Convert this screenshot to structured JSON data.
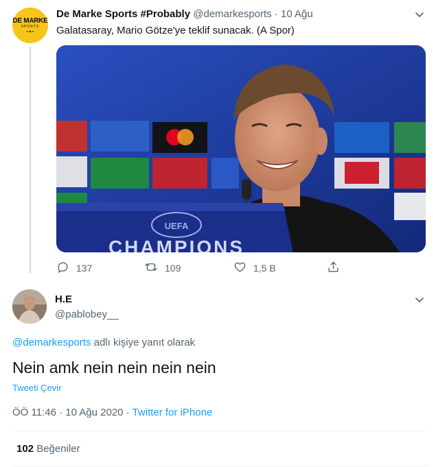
{
  "colors": {
    "accent": "#1d9bf0",
    "muted": "#536471",
    "text": "#0f1419",
    "avatar_bg": "#f5c518"
  },
  "parent_tweet": {
    "avatar_text": [
      "DE MARKE",
      "SPORTS",
      "● ◆ ●"
    ],
    "display_name": "De Marke Sports #Probably",
    "handle": "@demarkesports",
    "separator": "·",
    "date": "10 Ağu",
    "text": "Galatasaray, Mario Götze'ye teklif sunacak. (A Spor)",
    "media_text": "CHAMPIONS",
    "replies": "137",
    "retweets": "109",
    "likes": "1,5 B"
  },
  "reply_tweet": {
    "display_name": "H.E",
    "handle": "@pablobey__",
    "replying_mention": "@demarkesports",
    "replying_suffix": " adlı kişiye yanıt olarak",
    "text": "Nein amk nein nein nein nein",
    "translate_label": "Tweeti Çevir",
    "time": "ÖÖ 11:46 · 10 Ağu 2020",
    "source_sep": " · ",
    "source": "Twitter for iPhone",
    "like_count": "102",
    "like_label": "Beğeniler"
  },
  "icons": [
    "chevron-down-icon",
    "reply-icon",
    "retweet-icon",
    "like-icon",
    "share-icon"
  ]
}
